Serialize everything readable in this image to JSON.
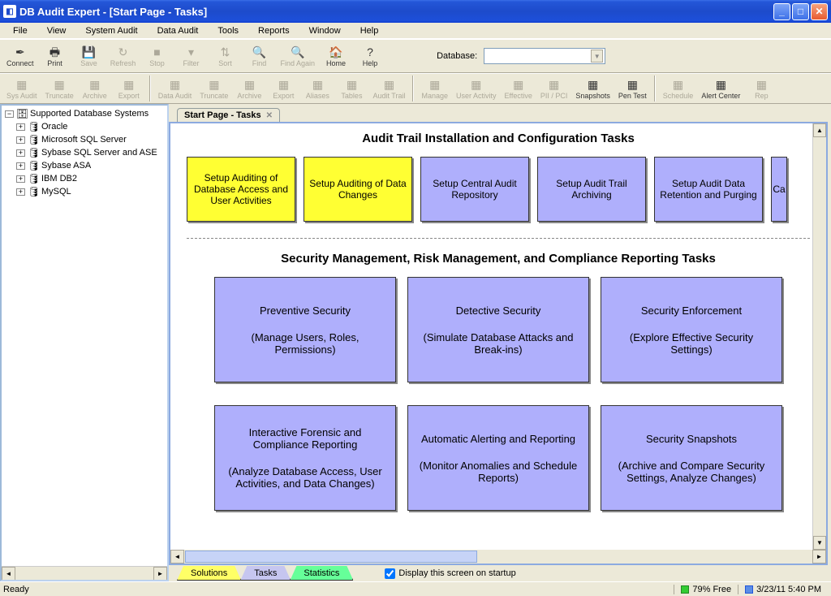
{
  "title": "DB Audit Expert - [Start Page - Tasks]",
  "menu": [
    "File",
    "View",
    "System Audit",
    "Data Audit",
    "Tools",
    "Reports",
    "Window",
    "Help"
  ],
  "toolbar1": [
    {
      "label": "Connect",
      "icon": "✒",
      "enabled": true
    },
    {
      "label": "Print",
      "icon": "🖶",
      "enabled": true
    },
    {
      "label": "Save",
      "icon": "💾",
      "enabled": false
    },
    {
      "label": "Refresh",
      "icon": "↻",
      "enabled": false
    },
    {
      "label": "Stop",
      "icon": "■",
      "enabled": false
    },
    {
      "label": "Filter",
      "icon": "▾",
      "enabled": false
    },
    {
      "label": "Sort",
      "icon": "⇅",
      "enabled": false
    },
    {
      "label": "Find",
      "icon": "🔍",
      "enabled": false
    },
    {
      "label": "Find Again",
      "icon": "🔍",
      "enabled": false
    },
    {
      "label": "Home",
      "icon": "🏠",
      "enabled": true
    },
    {
      "label": "Help",
      "icon": "?",
      "enabled": true
    }
  ],
  "db_label": "Database:",
  "toolbar2": [
    {
      "label": "Sys Audit",
      "enabled": false
    },
    {
      "label": "Truncate",
      "enabled": false
    },
    {
      "label": "Archive",
      "enabled": false
    },
    {
      "label": "Export",
      "enabled": false
    },
    {
      "sep": true
    },
    {
      "label": "Data Audit",
      "enabled": false
    },
    {
      "label": "Truncate",
      "enabled": false
    },
    {
      "label": "Archive",
      "enabled": false
    },
    {
      "label": "Export",
      "enabled": false
    },
    {
      "label": "Aliases",
      "enabled": false
    },
    {
      "label": "Tables",
      "enabled": false
    },
    {
      "label": "Audit Trail",
      "enabled": false
    },
    {
      "sep": true
    },
    {
      "label": "Manage",
      "enabled": false
    },
    {
      "label": "User Activity",
      "enabled": false
    },
    {
      "label": "Effective",
      "enabled": false
    },
    {
      "label": "PII / PCI",
      "enabled": false
    },
    {
      "label": "Snapshots",
      "enabled": true
    },
    {
      "label": "Pen Test",
      "enabled": true
    },
    {
      "sep": true
    },
    {
      "label": "Schedule",
      "enabled": false
    },
    {
      "label": "Alert Center",
      "enabled": true
    },
    {
      "label": "Rep",
      "enabled": false
    }
  ],
  "tree": {
    "root": "Supported Database Systems",
    "children": [
      "Oracle",
      "Microsoft SQL Server",
      "Sybase SQL Server and ASE",
      "Sybase ASA",
      "IBM DB2",
      "MySQL"
    ]
  },
  "doc_tab": "Start Page - Tasks",
  "section1_title": "Audit Trail Installation and Configuration Tasks",
  "row1": [
    {
      "text": "Setup Auditing of Database Access and User Activities",
      "yellow": true
    },
    {
      "text": "Setup Auditing of Data Changes",
      "yellow": true
    },
    {
      "text": "Setup Central Audit Repository"
    },
    {
      "text": "Setup Audit Trail Archiving"
    },
    {
      "text": "Setup Audit Data Retention and Purging"
    },
    {
      "text": "Ca",
      "cut": true
    }
  ],
  "section2_title": "Security Management, Risk Management, and Compliance Reporting Tasks",
  "row2": [
    {
      "title": "Preventive Security",
      "sub": "(Manage Users, Roles, Permissions)"
    },
    {
      "title": "Detective Security",
      "sub": "(Simulate Database Attacks and Break-ins)"
    },
    {
      "title": "Security Enforcement",
      "sub": "(Explore Effective Security Settings)"
    }
  ],
  "row3": [
    {
      "title": "Interactive Forensic and Compliance Reporting",
      "sub": "(Analyze Database Access, User Activities, and Data Changes)"
    },
    {
      "title": "Automatic Alerting and Reporting",
      "sub": "(Monitor Anomalies and Schedule Reports)"
    },
    {
      "title": "Security Snapshots",
      "sub": "(Archive and Compare Security Settings, Analyze Changes)"
    }
  ],
  "bottom_tabs": {
    "solutions": "Solutions",
    "tasks": "Tasks",
    "statistics": "Statistics"
  },
  "startup_label": "Display this screen on startup",
  "startup_checked": true,
  "status": {
    "ready": "Ready",
    "free": "79% Free",
    "datetime": "3/23/11 5:40 PM"
  }
}
